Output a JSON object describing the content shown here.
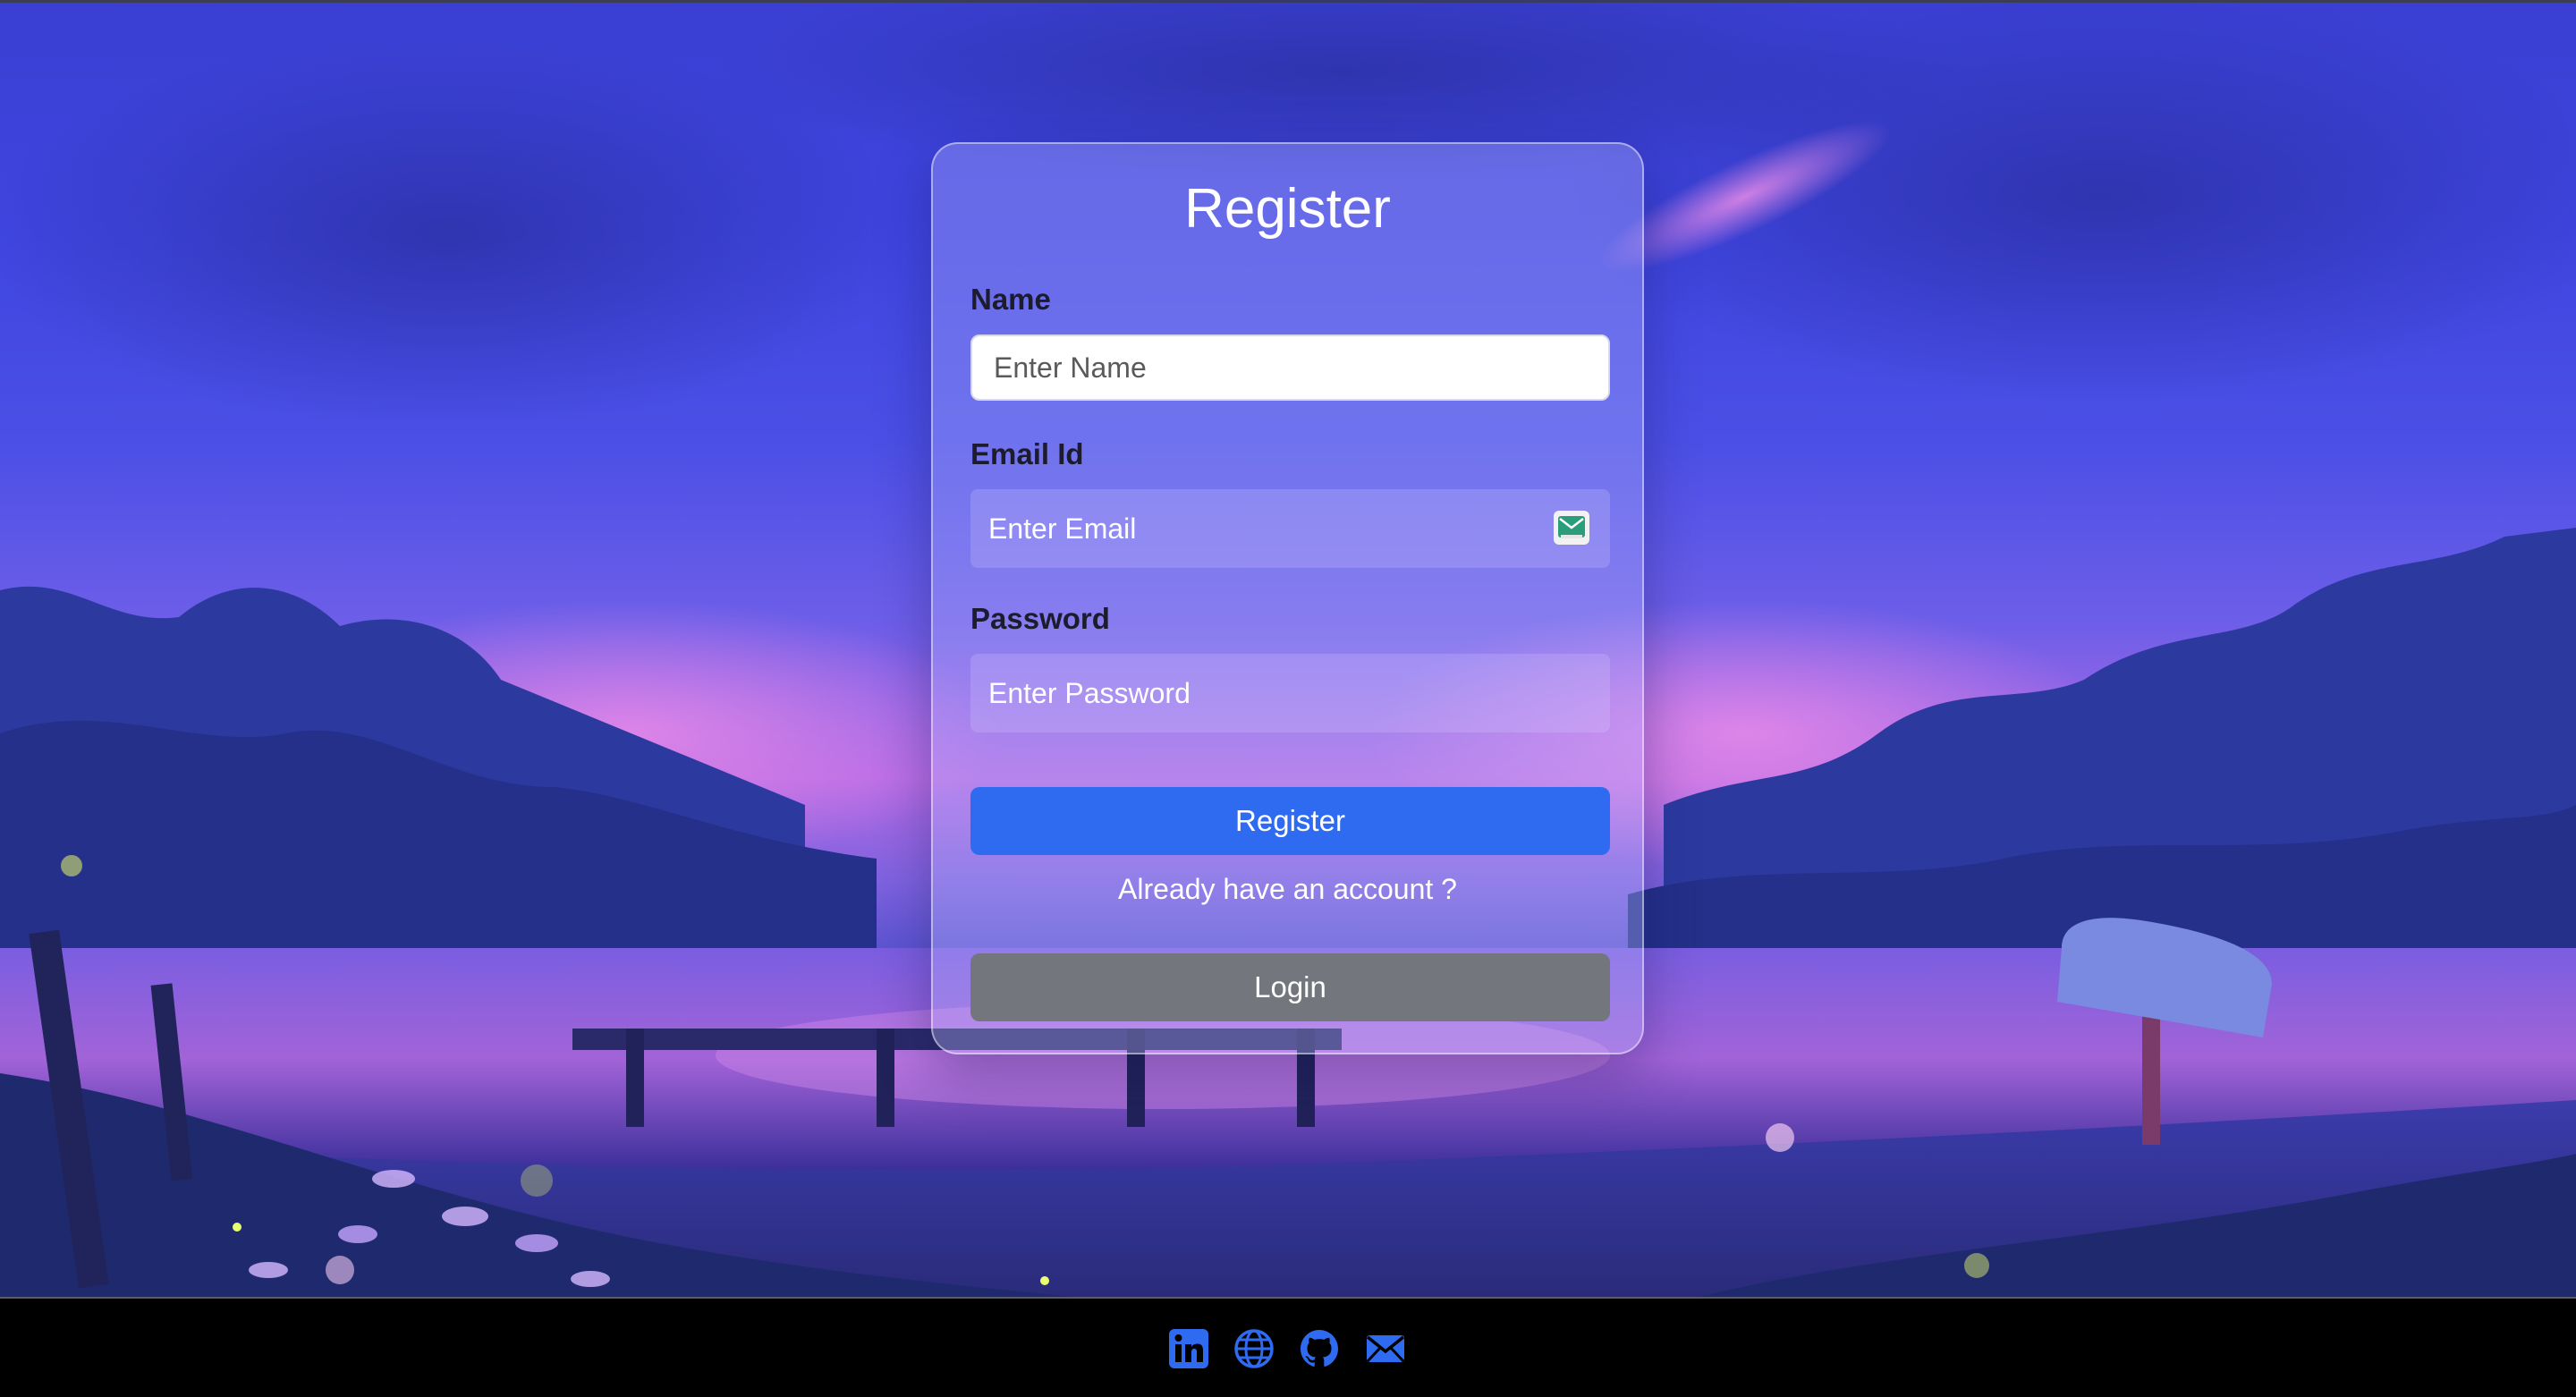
{
  "form": {
    "title": "Register",
    "name_label": "Name",
    "name_placeholder": "Enter Name",
    "email_label": "Email Id",
    "email_placeholder": "Enter Email",
    "password_label": "Password",
    "password_placeholder": "Enter Password",
    "register_button": "Register",
    "switch_text": "Already have an account ?",
    "login_button": "Login"
  },
  "footer": {
    "icons": [
      "linkedin-icon",
      "globe-icon",
      "github-icon",
      "mail-icon"
    ]
  },
  "colors": {
    "primary_button": "#2f6bf0",
    "secondary_button": "#73767c",
    "footer_icon": "#2f6bf0",
    "footer_background": "#000000"
  }
}
